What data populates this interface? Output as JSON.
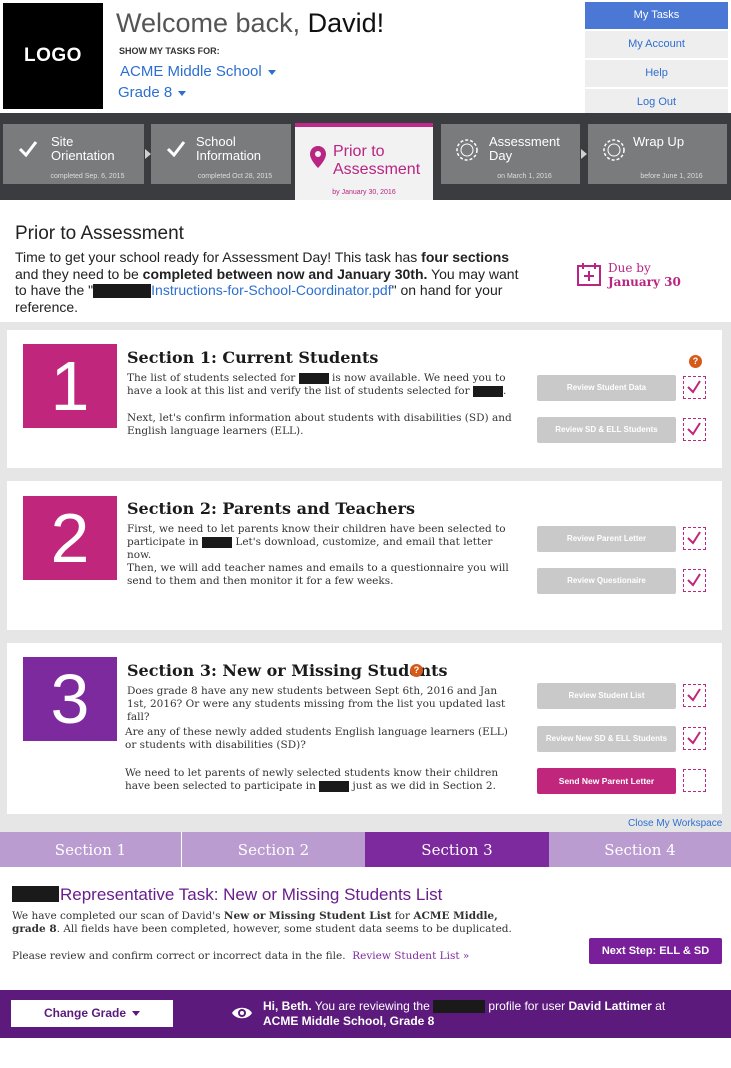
{
  "header": {
    "logo": "LOGO",
    "welcome": "Welcome back,",
    "user_name": "David!",
    "show_tasks_label": "SHOW MY TASKS FOR:",
    "school": "ACME Middle School",
    "grade": "Grade 8"
  },
  "nav": [
    "My Tasks",
    "My Account",
    "Help",
    "Log Out"
  ],
  "steps": [
    {
      "title1": "Site",
      "title2": "Orientation",
      "sub": "completed Sep. 6, 2015"
    },
    {
      "title1": "School",
      "title2": "Information",
      "sub": "completed Oct 28, 2015"
    },
    {
      "title1": "Prior to",
      "title2": "Assessment",
      "sub": "by January 30, 2016"
    },
    {
      "title1": "Assessment",
      "title2": "Day",
      "sub": "on March 1, 2016"
    },
    {
      "title1": "Wrap Up",
      "title2": "",
      "sub": "before June 1, 2016"
    }
  ],
  "intro": {
    "title": "Prior to Assessment",
    "t1": "Time to get your school ready for Assessment Day! This task has ",
    "b1": "four sections",
    "t2": " and they need to be ",
    "b2": "completed between now and January 30th.",
    "t3": " You may want to have the \"",
    "link": "Instructions-for-School-Coordinator.pdf",
    "t4": "\" on hand for your reference.",
    "due1": "Due by",
    "due2": "January 30"
  },
  "sections": [
    {
      "num": "1",
      "title": "Section 1: Current Students",
      "p1a": "The list of students selected for ",
      "p1b": " is now available. We need you to have a look at this list and verify the list of students selected for ",
      "p1c": ".",
      "p2": "Next, let's confirm information about students with disabilities (SD) and English language learners (ELL).",
      "btn1": "Review Student Data",
      "btn2": "Review SD & ELL Students"
    },
    {
      "num": "2",
      "title": "Section 2: Parents and Teachers",
      "p1a": "First, we need to let parents know their children have been selected to participate in ",
      "p1b": " Let's download, customize, and email that letter now.",
      "p2": "Then, we will add teacher names and emails to a questionnaire you will send to them and then monitor it for a few weeks.",
      "btn1": "Review Parent Letter",
      "btn2": "Review Questionaire"
    },
    {
      "num": "3",
      "title": "Section 3: New or Missing Students",
      "p1": "Does grade 8 have any new students between Sept 6th, 2016 and Jan 1st, 2016? Or were any students missing from the list you updated last fall?",
      "p2": "Are any of these newly added students English language learners (ELL) or students with disabilities (SD)?",
      "p3a": "We need to let parents of newly selected students know their children have been selected to participate in ",
      "p3b": " just as we did in Section 2.",
      "btn1": "Review Student List",
      "btn2": "Review New SD & ELL Students",
      "btn3": "Send New Parent Letter"
    }
  ],
  "help_glyph": "?",
  "close_workspace": "Close My Workspace",
  "tabs": [
    "Section 1",
    "Section 2",
    "Section 3",
    "Section 4"
  ],
  "rep": {
    "title": "Representative Task: New or Missing Students List",
    "t1": "We have completed our scan of David's ",
    "b1": "New or Missing Student List",
    "t2": " for ",
    "b2": "ACME Middle, grade 8",
    "t3": ". All fields have been completed, however, some student data seems to be duplicated.",
    "review_text": "Please review and confirm correct or incorrect data in the file.",
    "review_link": "Review Student List »",
    "next_step": "Next Step: ELL & SD"
  },
  "footer": {
    "change_grade": "Change Grade",
    "hi": "Hi, Beth.",
    "t1": " You are reviewing the ",
    "t2": " profile for user ",
    "user": "David Lattimer",
    "t3": " at ",
    "school": "ACME Middle School, Grade 8"
  },
  "colors": {
    "magenta": "#c0267c",
    "purple": "#7e2a9f",
    "blue": "#2d6fd0",
    "dark_bar": "#3b3c3f"
  }
}
